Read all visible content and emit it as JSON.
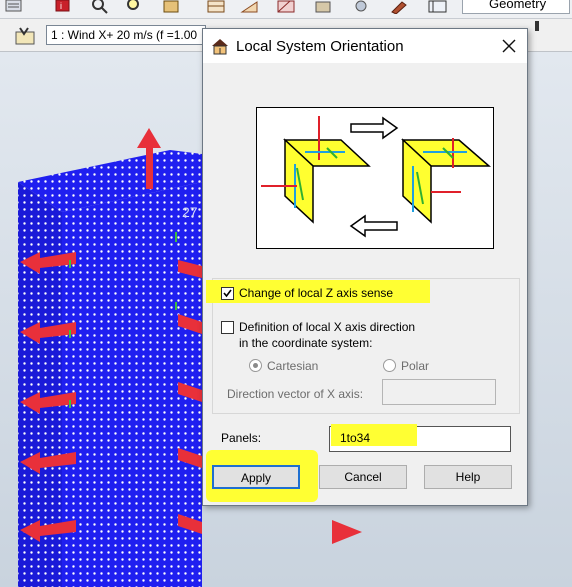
{
  "toolbar": {
    "structure_type": "Geometry",
    "load_case": "1 : Wind X+ 20 m/s (f =1.00"
  },
  "viewport": {
    "panel_number_label": "27"
  },
  "dialog": {
    "title": "Local System Orientation",
    "change_z_label": "Change of local Z axis sense",
    "change_z_checked": true,
    "definition_x_label_line1": "Definition of local X axis direction",
    "definition_x_label_line2": "in the coordinate system:",
    "definition_x_checked": false,
    "cartesian_label": "Cartesian",
    "polar_label": "Polar",
    "coordinate_system_selected": "Cartesian",
    "direction_vector_label": "Direction vector of X axis:",
    "direction_vector_value": "",
    "panels_label": "Panels:",
    "panels_value": "1to34",
    "apply_label": "Apply",
    "cancel_label": "Cancel",
    "help_label": "Help"
  },
  "colors": {
    "highlight": "#ffff33",
    "structure_blue": "#1a1aff",
    "arrow_red": "#e8303a"
  }
}
